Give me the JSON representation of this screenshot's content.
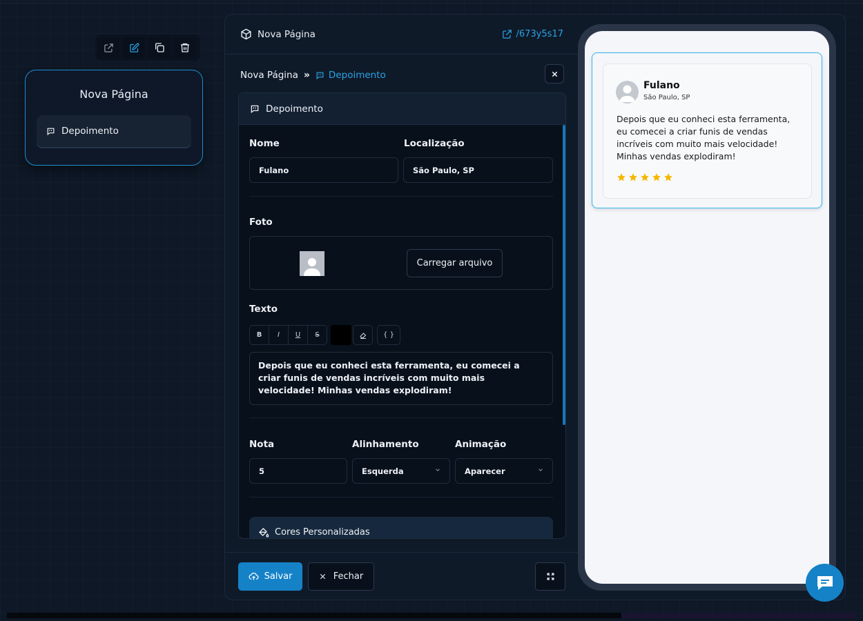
{
  "node": {
    "title": "Nova Página",
    "item_label": "Depoimento",
    "toolbar_icons": [
      "external-link-icon",
      "edit-icon",
      "copy-icon",
      "trash-icon"
    ]
  },
  "panel": {
    "title": "Nova Página",
    "link_label": "/673y5s17",
    "breadcrumb": {
      "root": "Nova Página",
      "separator": "»",
      "current": "Depoimento"
    },
    "section_title": "Depoimento"
  },
  "form": {
    "nome": {
      "label": "Nome",
      "value": "Fulano"
    },
    "localizacao": {
      "label": "Localização",
      "value": "São Paulo, SP"
    },
    "foto": {
      "label": "Foto",
      "upload_label": "Carregar arquivo"
    },
    "texto": {
      "label": "Texto",
      "toolbar": [
        "B",
        "I",
        "U",
        "S",
        "{ }"
      ],
      "value": "Depois que eu conheci esta ferramenta, eu comecei a criar funis de vendas incríveis com muito mais velocidade! Minhas vendas explodiram!"
    },
    "nota": {
      "label": "Nota",
      "value": "5"
    },
    "alinhamento": {
      "label": "Alinhamento",
      "value": "Esquerda"
    },
    "animacao": {
      "label": "Animação",
      "value": "Aparecer"
    },
    "cores_label": "Cores Personalizadas"
  },
  "footer": {
    "save_label": "Salvar",
    "close_label": "Fechar"
  },
  "preview": {
    "name": "Fulano",
    "location": "São Paulo, SP",
    "text": "Depois que eu conheci esta ferramenta, eu comecei a criar funis de vendas incríveis com muito mais velocidade! Minhas vendas explodiram!",
    "rating": 5,
    "star_color": "#f5b800"
  },
  "colors": {
    "accent": "#1582c8",
    "link": "#2ba3e5",
    "selection": "#36b4ee"
  }
}
